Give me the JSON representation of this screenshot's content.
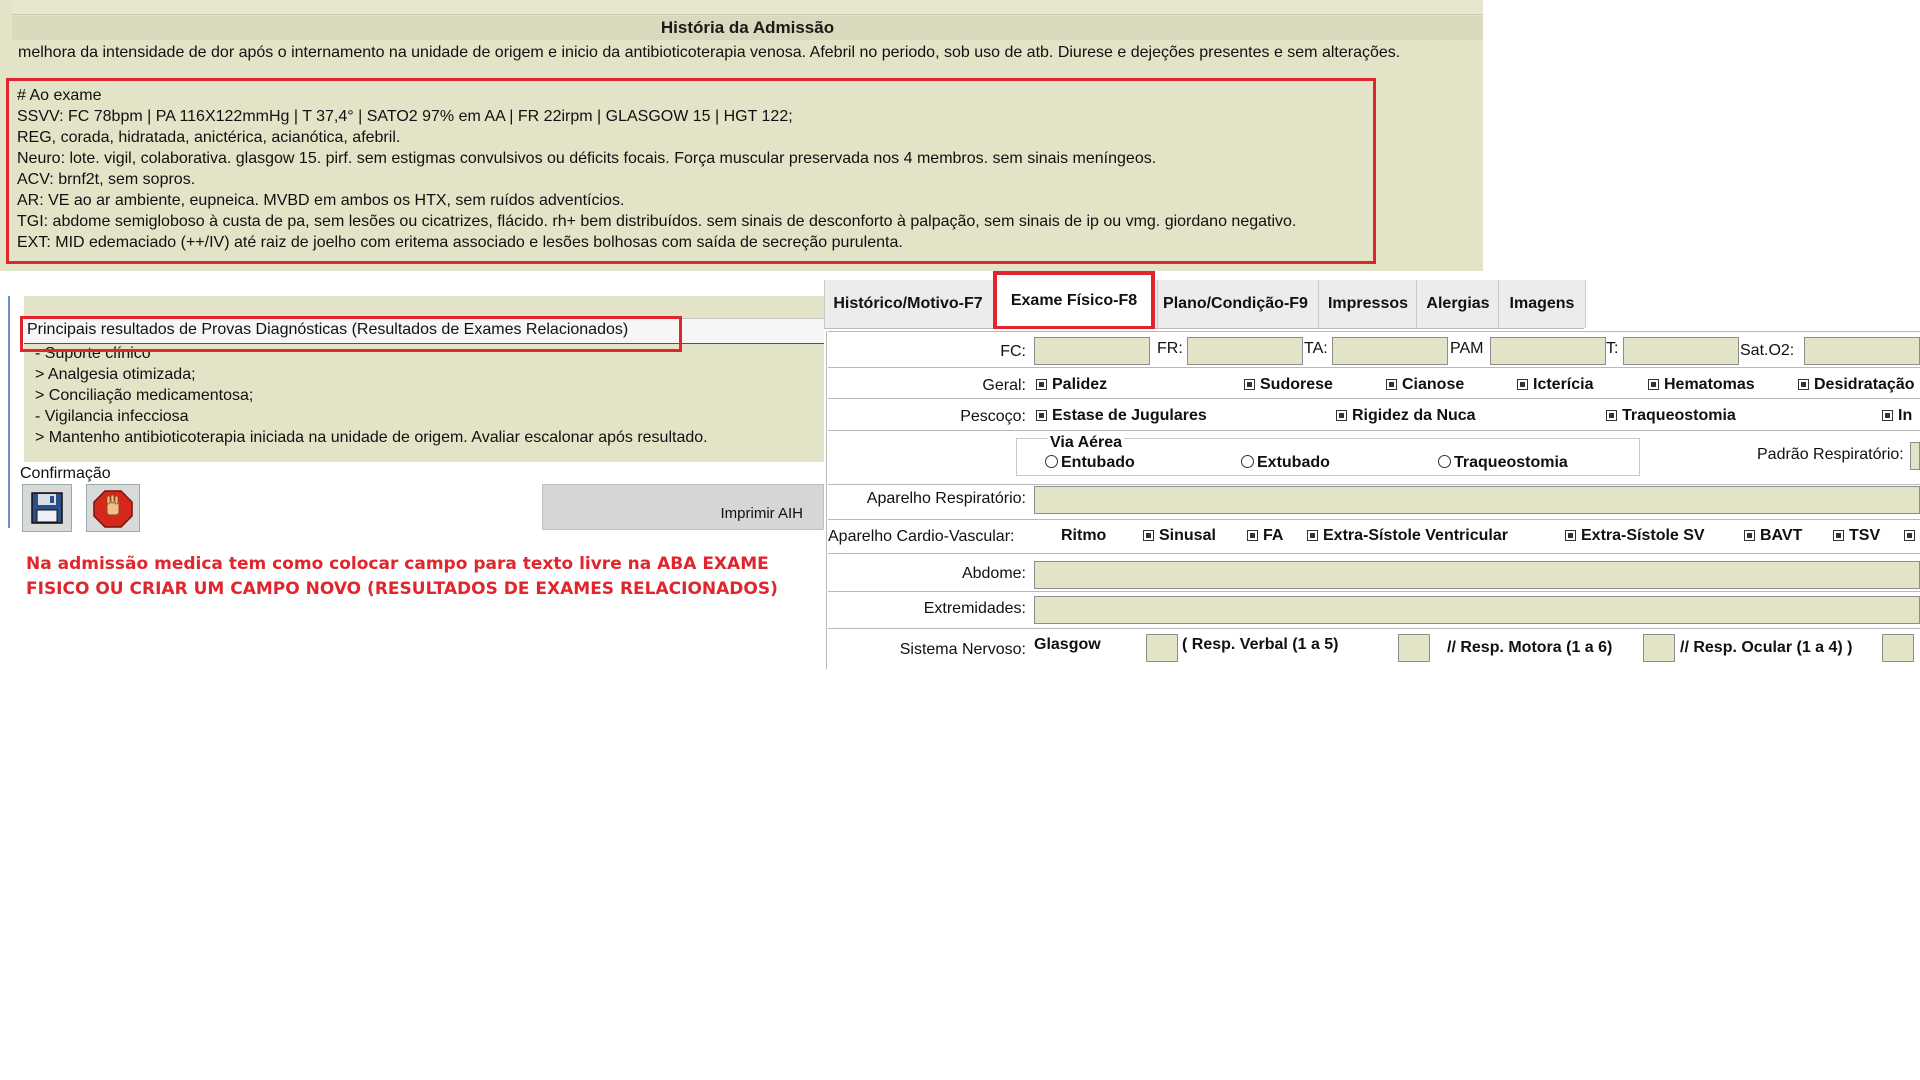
{
  "history": {
    "title": "História da Admissão",
    "summary_line": "melhora da intensidade de dor após o internamento na unidade de origem e inicio da antibioticoterapia venosa. Afebril no periodo, sob uso de atb. Diurese e dejeções presentes e sem alterações.",
    "exam_lines": [
      "# Ao exame",
      "SSVV: FC 78bpm | PA 116X122mmHg | T 37,4° | SATO2 97% em AA | FR 22irpm | GLASGOW 15 | HGT 122;",
      "REG, corada, hidratada, anictérica, acianótica, afebril.",
      "Neuro: lote. vigil, colaborativa. glasgow 15. pirf. sem estigmas convulsivos ou déficits focais. Força muscular preservada nos 4 membros. sem sinais meníngeos.",
      "ACV: brnf2t, sem sopros.",
      "AR: VE ao ar ambiente, eupneica. MVBD em ambos os HTX, sem ruídos adventícios.",
      "TGI: abdome semigloboso à custa de pa, sem lesões ou cicatrizes, flácido. rh+ bem distribuídos. sem sinais de desconforto à palpação, sem sinais de ip ou vmg. giordano negativo.",
      "EXT: MID edemaciado (++/IV) até raiz de joelho com eritema associado e lesões bolhosas com saída de secreção purulenta."
    ]
  },
  "results": {
    "title": "Principais resultados de Provas Diagnósticas (Resultados de Exames Relacionados)",
    "plan_lines": [
      "- Suporte clínico",
      "> Analgesia otimizada;",
      "> Conciliação medicamentosa;",
      "- Vigilancia infecciosa",
      "> Mantenho antibioticoterapia iniciada na unidade de origem. Avaliar escalonar após resultado."
    ]
  },
  "confirmation": {
    "label": "Confirmação",
    "print_label": "Imprimir AIH"
  },
  "note": "Na admissão medica tem como colocar campo para texto livre na ABA EXAME FISICO OU CRIAR UM CAMPO NOVO (RESULTADOS DE EXAMES RELACIONADOS)",
  "tabs": [
    "Histórico/Motivo-F7",
    "Exame Físico-F8",
    "Plano/Condição-F9",
    "Impressos",
    "Alergias",
    "Imagens"
  ],
  "form": {
    "vitals_labels": [
      "FC:",
      "FR:",
      "TA:",
      "PAM",
      "T:",
      "Sat.O2:"
    ],
    "geral_label": "Geral:",
    "geral_items": [
      "Palidez",
      "Sudorese",
      "Cianose",
      "Icterícia",
      "Hematomas",
      "Desidratação"
    ],
    "pescoco_label": "Pescoço:",
    "pescoco_items": [
      "Estase de Jugulares",
      "Rigidez da Nuca",
      "Traqueostomia",
      "In"
    ],
    "via_aerea_title": "Via Aérea",
    "via_aerea_options": [
      "Entubado",
      "Extubado",
      "Traqueostomia"
    ],
    "padrao_label": "Padrão Respiratório:",
    "resp_label": "Aparelho Respiratório:",
    "cardio_label": "Aparelho Cardio-Vascular:",
    "ritmo_label": "Ritmo",
    "cardio_items": [
      "Sinusal",
      "FA",
      "Extra-Sístole Ventricular",
      "Extra-Sístole SV",
      "BAVT",
      "TSV"
    ],
    "abdome_label": "Abdome:",
    "extremidades_label": "Extremidades:",
    "nervoso_label": "Sistema Nervoso:",
    "glasgow_label": "Glasgow",
    "verbal_label": "( Resp. Verbal (1 a 5)",
    "motora_label": "// Resp. Motora (1 a 6)",
    "ocular_label": "// Resp. Ocular (1 a 4) )"
  },
  "colors": {
    "highlight": "#e0262c",
    "panel": "#e3e3c7"
  }
}
